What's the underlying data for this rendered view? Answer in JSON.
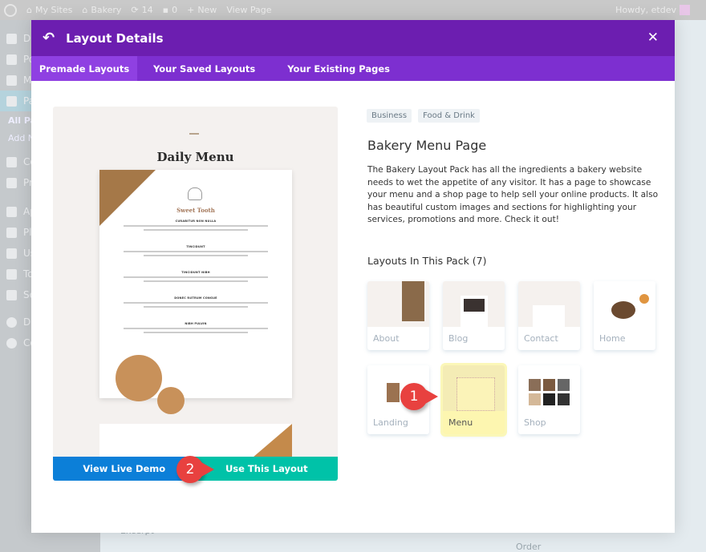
{
  "adminbar": {
    "my_sites": "My Sites",
    "site": "Bakery",
    "updates": "14",
    "comments": "0",
    "new": "New",
    "view_page": "View Page",
    "howdy": "Howdy, etdev"
  },
  "sidebar": {
    "items": [
      "Da",
      "Po",
      "Me",
      "Pa",
      "Co",
      "Pr",
      "Ap",
      "Pl",
      "Us",
      "To",
      "Se",
      "Di",
      "Co"
    ],
    "sub": [
      "All Pa",
      "Add N"
    ]
  },
  "background": {
    "excerpt": "Excerpt",
    "order": "Order"
  },
  "modal": {
    "title": "Layout Details",
    "tabs": [
      {
        "label": "Premade Layouts",
        "active": true
      },
      {
        "label": "Your Saved Layouts"
      },
      {
        "label": "Your Existing Pages"
      }
    ],
    "preview": {
      "title": "Daily Menu",
      "section": "Sweet Tooth",
      "items": [
        "CURABITUR NON NULLA",
        "TINCIDUNT",
        "TINCIDUNT NIBH",
        "DONEC RUTRUM CONGUE",
        "NIBH PULVIN"
      ]
    },
    "buttons": {
      "demo": "View Live Demo",
      "use": "Use This Layout"
    },
    "tags": [
      "Business",
      "Food & Drink"
    ],
    "layout_title": "Bakery Menu Page",
    "description": "The Bakery Layout Pack has all the ingredients a bakery website needs to wet the appetite of any visitor. It has a page to showcase your menu and a shop page to help sell your online products. It also has beautiful custom images and sections for highlighting your services, promotions and more. Check it out!",
    "pack_title": "Layouts In This Pack (7)",
    "layouts": [
      {
        "label": "About"
      },
      {
        "label": "Blog"
      },
      {
        "label": "Contact"
      },
      {
        "label": "Home"
      },
      {
        "label": "Landing"
      },
      {
        "label": "Menu",
        "selected": true
      },
      {
        "label": "Shop"
      }
    ]
  },
  "annotations": [
    "1",
    "2"
  ],
  "colors": {
    "header": "#6c1eb0",
    "tabs": "#7d2fd0",
    "demo": "#0c7fd8",
    "use": "#00c2a8",
    "badge": "#e8413f"
  }
}
